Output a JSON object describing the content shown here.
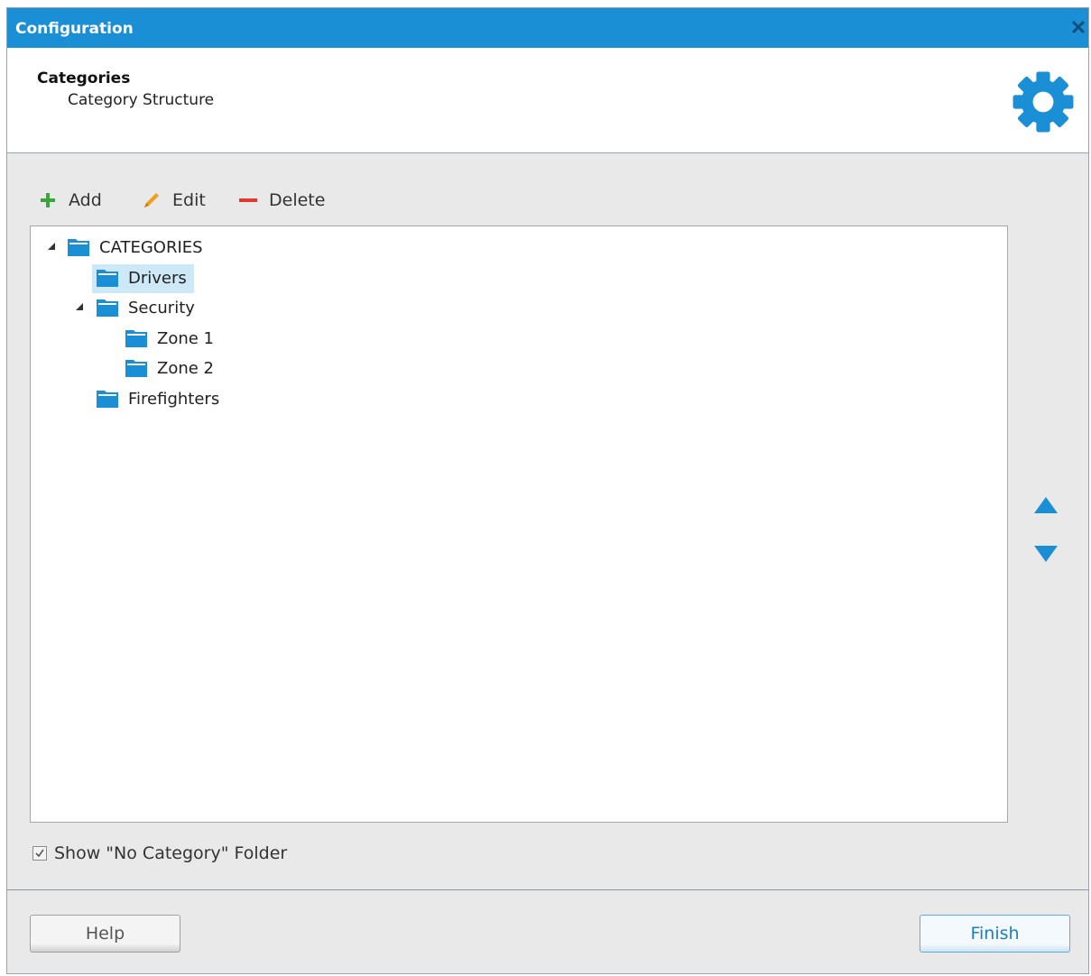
{
  "window": {
    "title": "Configuration"
  },
  "header": {
    "title": "Categories",
    "subtitle": "Category Structure"
  },
  "toolbar": {
    "add_label": "Add",
    "edit_label": "Edit",
    "delete_label": "Delete"
  },
  "tree": {
    "root": "CATEGORIES",
    "items": [
      {
        "label": "Drivers",
        "selected": true
      },
      {
        "label": "Security",
        "expanded": true,
        "children": [
          {
            "label": "Zone 1"
          },
          {
            "label": "Zone 2"
          }
        ]
      },
      {
        "label": "Firefighters"
      }
    ]
  },
  "show_no_category": {
    "label": "Show \"No Category\" Folder",
    "checked": true
  },
  "buttons": {
    "help": "Help",
    "finish": "Finish"
  },
  "colors": {
    "accent": "#1b8fd6",
    "selection": "#cde8f7",
    "add": "#3aa53a",
    "edit": "#f0a020",
    "delete": "#e03a2f"
  }
}
